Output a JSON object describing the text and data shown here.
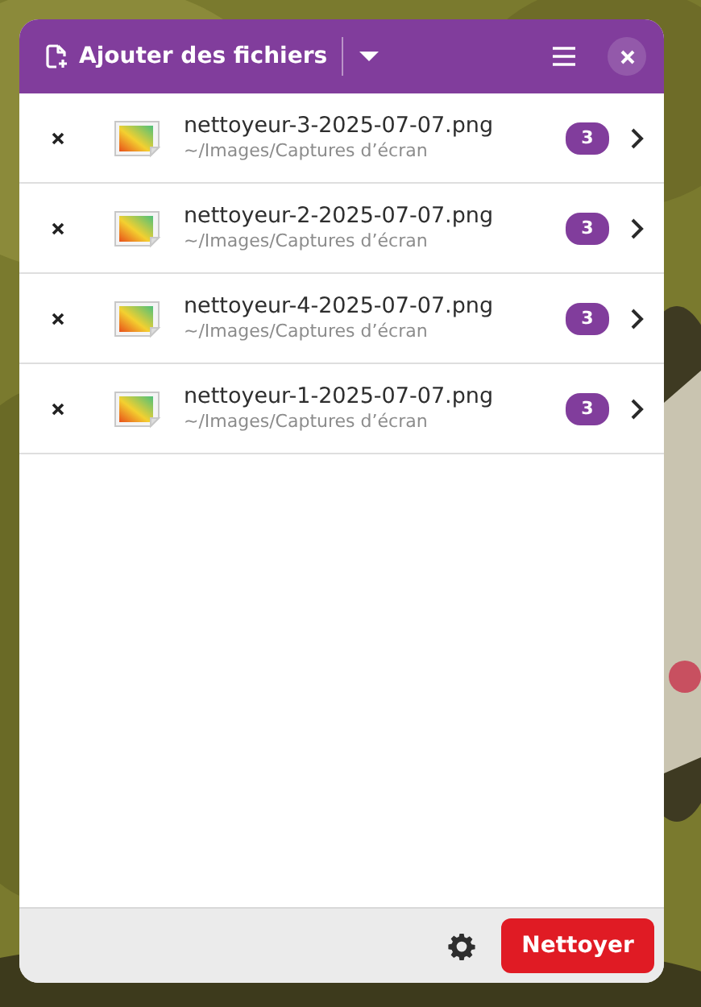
{
  "header": {
    "add_button": "Ajouter des fichiers"
  },
  "files": [
    {
      "name": "nettoyeur-3-2025-07-07.png",
      "path": "~/Images/Captures d’écran",
      "count": "3"
    },
    {
      "name": "nettoyeur-2-2025-07-07.png",
      "path": "~/Images/Captures d’écran",
      "count": "3"
    },
    {
      "name": "nettoyeur-4-2025-07-07.png",
      "path": "~/Images/Captures d’écran",
      "count": "3"
    },
    {
      "name": "nettoyeur-1-2025-07-07.png",
      "path": "~/Images/Captures d’écran",
      "count": "3"
    }
  ],
  "footer": {
    "clean_button": "Nettoyer"
  }
}
